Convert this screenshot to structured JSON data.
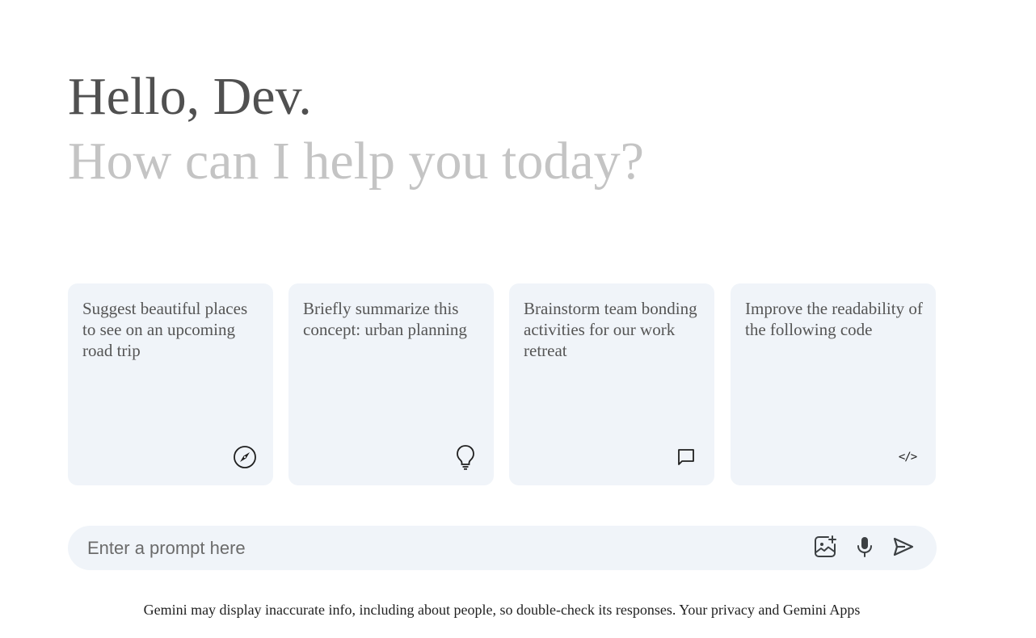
{
  "greeting": {
    "hello": "Hello, Dev.",
    "help": "How can I help you today?"
  },
  "cards": [
    {
      "text": "Suggest beautiful places to see on an upcoming road trip",
      "icon": "compass-icon"
    },
    {
      "text": "Briefly summarize this concept: urban planning",
      "icon": "lightbulb-icon"
    },
    {
      "text": "Brainstorm team bonding activities for our work retreat",
      "icon": "chat-bubble-icon"
    },
    {
      "text": "Improve the readability of the following code",
      "icon": "code-icon",
      "glyph": "</>"
    }
  ],
  "prompt": {
    "placeholder": "Enter a prompt here",
    "value": ""
  },
  "actions": {
    "image": "add-image-icon",
    "mic": "microphone-icon",
    "send": "send-icon"
  },
  "footer": {
    "disclaimer": "Gemini may display inaccurate info, including about people, so double-check its responses. Your privacy and Gemini Apps"
  },
  "colors": {
    "card_bg": "#f0f4f9",
    "greeting_dark": "#505050",
    "greeting_light": "#c4c4c4"
  }
}
